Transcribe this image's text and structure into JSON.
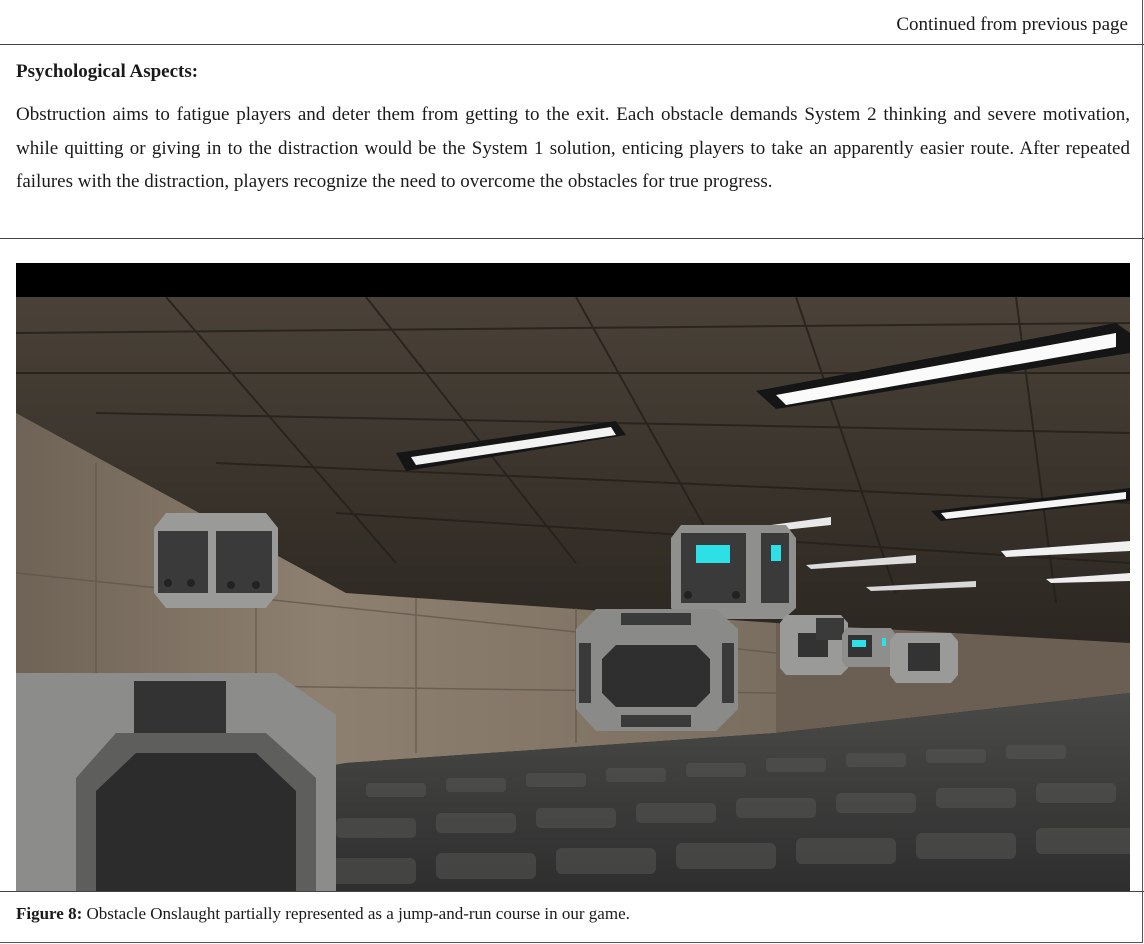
{
  "header": {
    "continued": "Continued from previous page"
  },
  "section": {
    "heading": "Psychological Aspects:",
    "paragraph": "Obstruction aims to fatigue players and deter them from getting to the exit. Each obstacle demands System 2 thinking and severe motivation, while quitting or giving in to the distraction would be the System 1 solution, enticing players to take an apparently easier route. After repeated failures with the distraction, players recognize the need to overcome the obstacles for true progress."
  },
  "figure": {
    "label": "Figure 8:",
    "caption": " Obstacle Onslaught partially represented as a jump-and-run course in our game.",
    "colors": {
      "ceiling": "#3a342d",
      "wall": "#7a6c5c",
      "floor": "#3c3c3c",
      "cube": "#8a8a88",
      "screen": "#2de0e6"
    }
  }
}
